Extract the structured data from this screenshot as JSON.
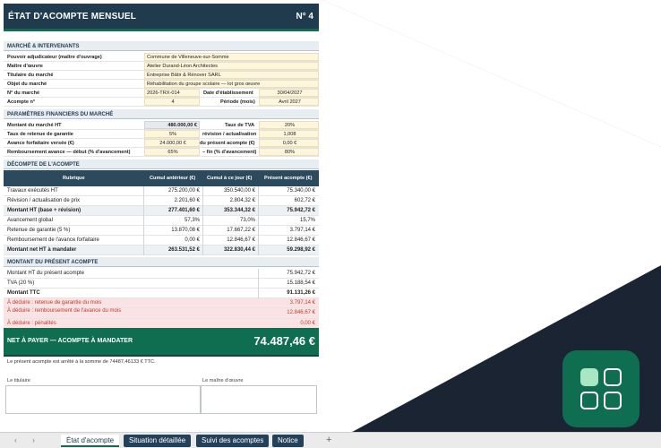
{
  "sheet": {
    "title": "ÉTAT D'ACOMPTE MENSUEL",
    "number": "N° 4",
    "sections": {
      "marche": "MARCHÉ & INTERVENANTS",
      "financiers": "PARAMÈTRES FINANCIERS DU MARCHÉ",
      "decompte": "DÉCOMPTE DE L'ACOMPTE",
      "montant": "MONTANT DU PRÉSENT ACOMPTE"
    },
    "marche": {
      "pouvoir_label": "Pouvoir adjudicateur (maître d'ouvrage)",
      "pouvoir_value": "Commune de Villeneuve-sur-Somme",
      "moe_label": "Maître d'œuvre",
      "moe_value": "Atelier Durand-Léon Architectes",
      "titulaire_label": "Titulaire du marché",
      "titulaire_value": "Entreprise Bâtir & Rénover SARL",
      "objet_label": "Objet du marché",
      "objet_value": "Réhabilitation du groupe scolaire — lot gros œuvre",
      "num_label": "N° du marché",
      "num_value": "2026-TRX-014",
      "date_label": "Date d'établissement",
      "date_value": "30/04/2027",
      "acompte_label": "Acompte n°",
      "acompte_value": "4",
      "periode_label": "Période (mois)",
      "periode_value": "Avril 2027"
    },
    "financiers": {
      "montant_label": "Montant du marché HT",
      "montant_value": "480.000,00 €",
      "tva_label": "Taux de TVA",
      "tva_value": "20%",
      "retenue_label": "Taux de retenue de garantie",
      "retenue_value": "5%",
      "revision_label": "révision / actualisation",
      "revision_value": "1,008",
      "avance_label": "Avance forfaitaire versée (€)",
      "avance_value": "24.000,00 €",
      "present_label": "du présent acompte (€)",
      "present_value": "0,00 €",
      "remb_label": "Remboursement avance — début (% d'avancement)",
      "remb_value": "65%",
      "fin_label": "– fin (% d'avancement)",
      "fin_value": "80%"
    },
    "table": {
      "headers": [
        "Rubrique",
        "Cumul antérieur (€)",
        "Cumul à ce jour (€)",
        "Présent acompte (€)"
      ],
      "rows": [
        {
          "label": "Travaux exécutés HT",
          "a": "275.200,00 €",
          "b": "350.540,00 €",
          "c": "75.340,00 €"
        },
        {
          "label": "Révision / actualisation de prix",
          "a": "2.201,60 €",
          "b": "2.804,32 €",
          "c": "602,72 €"
        },
        {
          "label": "Montant HT (base + révision)",
          "a": "277.401,60 €",
          "b": "353.344,32 €",
          "c": "75.942,72 €"
        },
        {
          "label": "Avancement global",
          "a": "57,3%",
          "b": "73,0%",
          "c": "15,7%"
        },
        {
          "label": "Retenue de garantie (5 %)",
          "a": "13.870,08 €",
          "b": "17.667,22 €",
          "c": "3.797,14 €"
        },
        {
          "label": "Remboursement de l'avance forfaitaire",
          "a": "0,00 €",
          "b": "12.846,67 €",
          "c": "12.846,67 €"
        },
        {
          "label": "Montant net HT à mandater",
          "a": "263.531,52 €",
          "b": "322.830,44 €",
          "c": "59.298,92 €"
        }
      ]
    },
    "summary": [
      {
        "label": "Montant HT du présent acompte",
        "value": "75.942,72 €"
      },
      {
        "label": "TVA (20 %)",
        "value": "15.188,54 €"
      },
      {
        "label": "Montant TTC",
        "value": "91.131,26 €"
      },
      {
        "label": "À déduire : retenue de garantie du mois",
        "value": "3.797,14 €"
      },
      {
        "label": "À déduire : remboursement de l'avance du mois",
        "value": "12.846,67 €"
      },
      {
        "label": "À déduire : pénalités",
        "value": "0,00 €"
      }
    ],
    "net_label": "NET À PAYER — ACOMPTE À MANDATER",
    "net_value": "74.487,46 €",
    "arrete": "Le présent acompte est arrêté à la somme de 74487,46133 € TTC.",
    "sig_titulaire": "Le titulaire",
    "sig_moe": "Le maître d'œuvre"
  },
  "tabs": {
    "nav_prev": "‹",
    "nav_next": "›",
    "items": [
      "État d'acompte",
      "Situation détaillée",
      "Suivi des acomptes",
      "Notice"
    ],
    "add": "+"
  },
  "colors": {
    "accent_green": "#0e6e4f",
    "header_navy": "#1f3b4d",
    "background_dark": "#1b2433"
  }
}
